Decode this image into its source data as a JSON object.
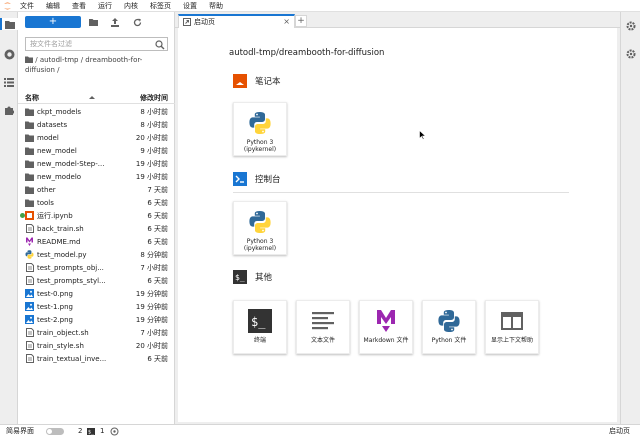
{
  "menu": [
    "文件",
    "编辑",
    "查看",
    "运行",
    "内核",
    "标签页",
    "设置",
    "帮助"
  ],
  "filebrowser": {
    "new_label": "+",
    "search_placeholder": "按文件名过滤",
    "breadcrumb": "/ autodl-tmp / dreambooth-for-diffusion /",
    "col_name": "名称",
    "col_modified": "修改时间",
    "files": [
      {
        "name": "ckpt_models",
        "date": "8 小时前",
        "icon": "folder-icon"
      },
      {
        "name": "datasets",
        "date": "8 小时前",
        "icon": "folder-icon"
      },
      {
        "name": "model",
        "date": "20 小时前",
        "icon": "folder-icon"
      },
      {
        "name": "new_model",
        "date": "9 小时前",
        "icon": "folder-icon"
      },
      {
        "name": "new_model-Step-...",
        "date": "19 小时前",
        "icon": "folder-icon"
      },
      {
        "name": "new_modelo",
        "date": "19 小时前",
        "icon": "folder-icon"
      },
      {
        "name": "other",
        "date": "7 天前",
        "icon": "folder-icon"
      },
      {
        "name": "tools",
        "date": "6 天前",
        "icon": "folder-icon"
      },
      {
        "name": "运行.ipynb",
        "date": "6 天前",
        "icon": "notebook-icon"
      },
      {
        "name": "back_train.sh",
        "date": "6 天前",
        "icon": "file-icon"
      },
      {
        "name": "README.md",
        "date": "6 天前",
        "icon": "markdown-icon"
      },
      {
        "name": "test_model.py",
        "date": "8 分钟前",
        "icon": "python-icon"
      },
      {
        "name": "test_prompts_obj...",
        "date": "7 小时前",
        "icon": "file-icon"
      },
      {
        "name": "test_prompts_styl...",
        "date": "6 天前",
        "icon": "file-icon"
      },
      {
        "name": "test-0.png",
        "date": "19 分钟前",
        "icon": "image-icon"
      },
      {
        "name": "test-1.png",
        "date": "19 分钟前",
        "icon": "image-icon"
      },
      {
        "name": "test-2.png",
        "date": "19 分钟前",
        "icon": "image-icon"
      },
      {
        "name": "train_object.sh",
        "date": "7 小时前",
        "icon": "file-icon"
      },
      {
        "name": "train_style.sh",
        "date": "20 小时前",
        "icon": "file-icon"
      },
      {
        "name": "train_textual_inve...",
        "date": "6 天前",
        "icon": "file-icon"
      }
    ]
  },
  "tab": {
    "label": "启动页"
  },
  "launcher": {
    "path": "autodl-tmp/dreambooth-for-diffusion",
    "sections": {
      "notebook": {
        "title": "笔记本",
        "card_label_1": "Python 3",
        "card_label_2": "(ipykernel)"
      },
      "console": {
        "title": "控制台",
        "card_label_1": "Python 3",
        "card_label_2": "(ipykernel)"
      },
      "other": {
        "title": "其他",
        "cards": [
          "终端",
          "文本文件",
          "Markdown 文件",
          "Python 文件",
          "显示上下文帮助"
        ]
      }
    }
  },
  "statusbar": {
    "simple_mode": "简易界面",
    "kernels": "2",
    "terminals": "1",
    "right_label": "启动页"
  },
  "colors": {
    "accent": "#1976d2",
    "orange": "#e65100",
    "python_blue": "#306998",
    "python_yellow": "#ffd43b",
    "markdown_purple": "#9c27b0"
  }
}
